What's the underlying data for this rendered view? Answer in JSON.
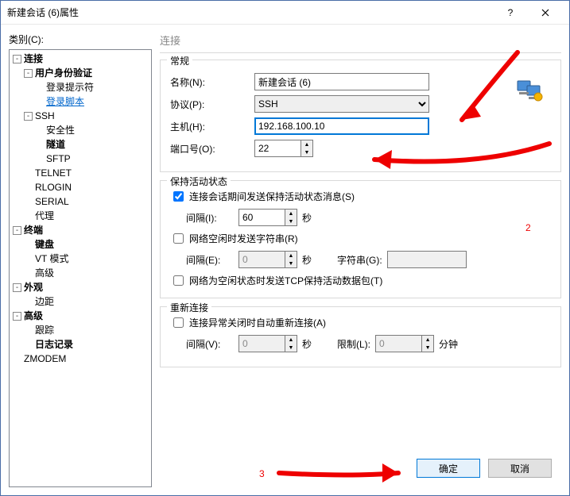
{
  "titlebar": {
    "title": "新建会话 (6)属性"
  },
  "leftcol": {
    "category_label": "类别(C):"
  },
  "tree": {
    "connection": "连接",
    "user_auth": "用户身份验证",
    "login_prompt": "登录提示符",
    "login_script": "登录脚本",
    "ssh": "SSH",
    "security": "安全性",
    "tunnel": "隧道",
    "sftp": "SFTP",
    "telnet": "TELNET",
    "rlogin": "RLOGIN",
    "serial": "SERIAL",
    "proxy": "代理",
    "terminal": "终端",
    "keyboard": "键盘",
    "vt_mode": "VT 模式",
    "advanced_term": "高级",
    "appearance": "外观",
    "margins": "边距",
    "advanced": "高级",
    "trace": "跟踪",
    "logging": "日志记录",
    "zmodem": "ZMODEM"
  },
  "panel": {
    "title": "连接"
  },
  "general": {
    "title": "常规",
    "name_label": "名称(N):",
    "name_value": "新建会话 (6)",
    "protocol_label": "协议(P):",
    "protocol_value": "SSH",
    "host_label": "主机(H):",
    "host_value": "192.168.100.10",
    "port_label": "端口号(O):",
    "port_value": "22"
  },
  "keepalive": {
    "title": "保持活动状态",
    "chk_send": "连接会话期间发送保持活动状态消息(S)",
    "chk_send_checked": true,
    "interval_i_label": "间隔(I):",
    "interval_i_value": "60",
    "seconds": "秒",
    "chk_idle": "网络空闲时发送字符串(R)",
    "chk_idle_checked": false,
    "interval_e_label": "间隔(E):",
    "interval_e_value": "0",
    "string_label": "字符串(G):",
    "string_value": "",
    "chk_tcp": "网络为空闲状态时发送TCP保持活动数据包(T)",
    "chk_tcp_checked": false
  },
  "reconnect": {
    "title": "重新连接",
    "chk_auto": "连接异常关闭时自动重新连接(A)",
    "chk_auto_checked": false,
    "interval_v_label": "间隔(V):",
    "interval_v_value": "0",
    "seconds": "秒",
    "limit_label": "限制(L):",
    "limit_value": "0",
    "minutes": "分钟"
  },
  "footer": {
    "ok": "确定",
    "cancel": "取消"
  },
  "annot": {
    "two": "2",
    "three": "3"
  }
}
